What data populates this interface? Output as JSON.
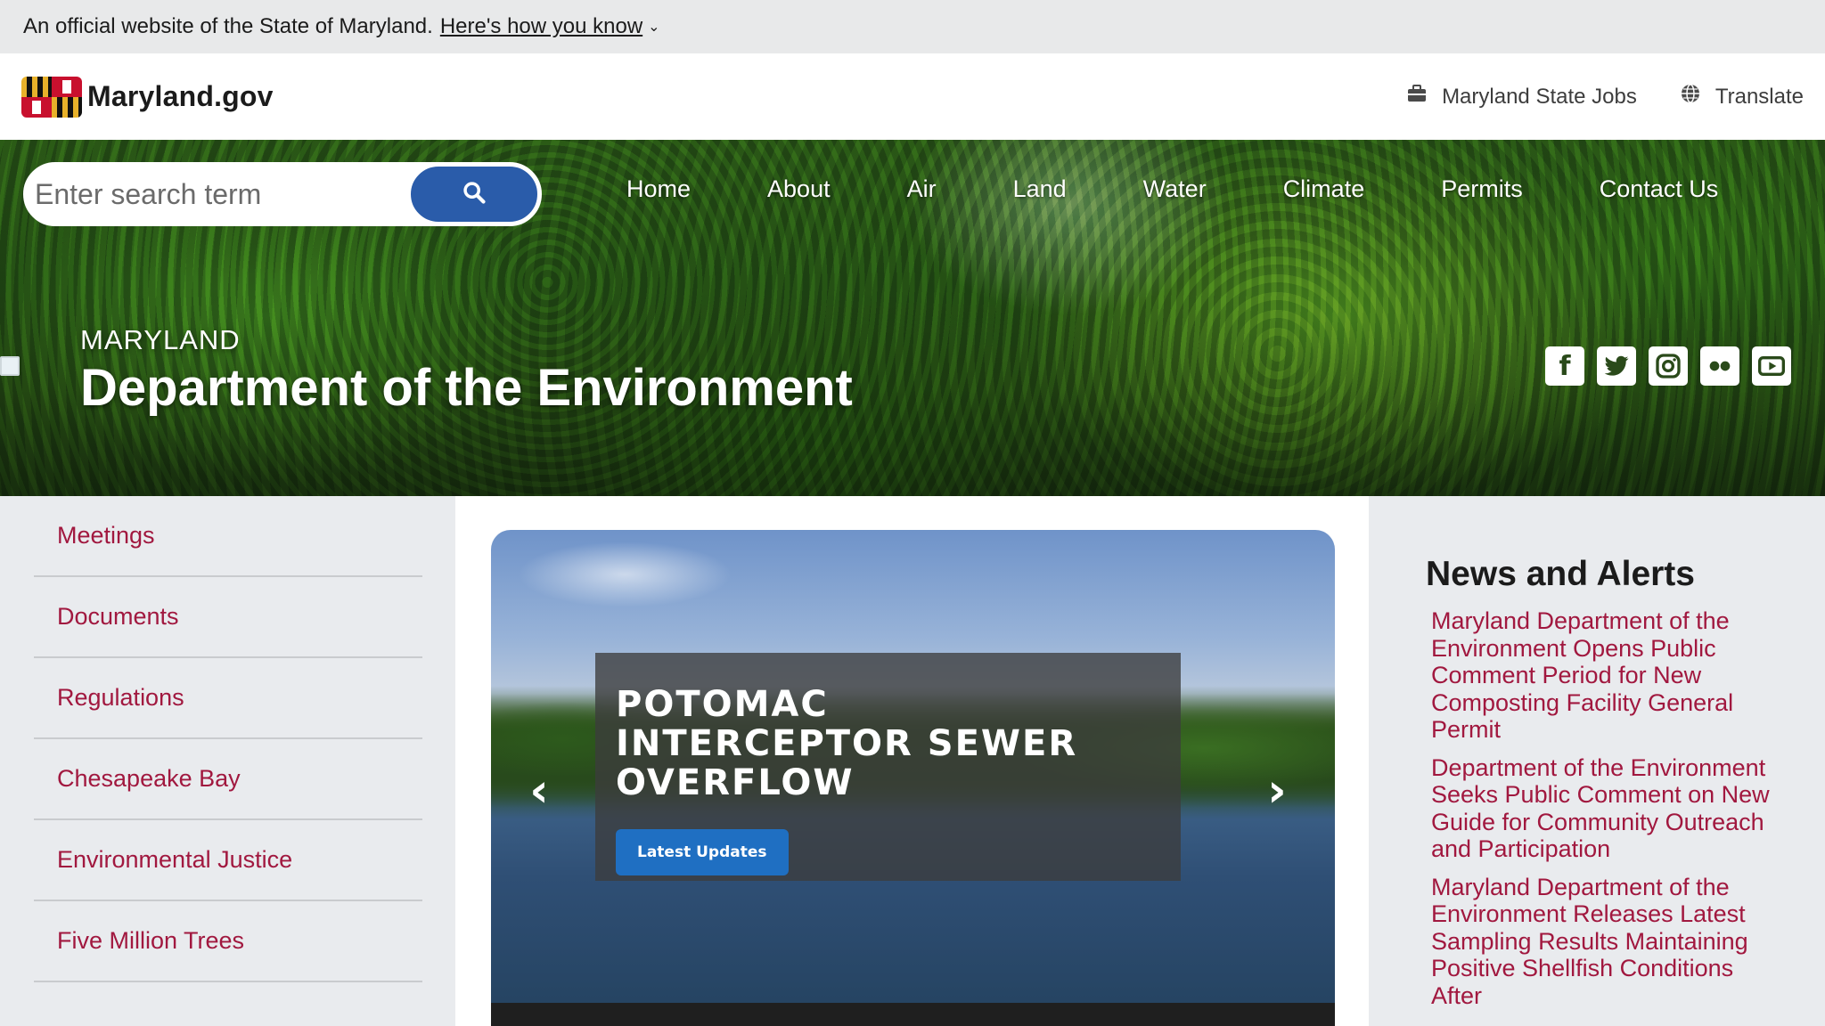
{
  "official_banner": {
    "text": "An official website of the State of Maryland.",
    "link": "Here's how you know"
  },
  "header": {
    "logo_text": "Maryland.gov",
    "jobs_link": "Maryland State Jobs",
    "translate_link": "Translate"
  },
  "search": {
    "placeholder": "Enter search term"
  },
  "nav": {
    "items": [
      "Home",
      "About",
      "Air",
      "Land",
      "Water",
      "Climate",
      "Permits",
      "Contact Us"
    ]
  },
  "hero": {
    "subtitle": "MARYLAND",
    "title": "Department of the Environment"
  },
  "social": [
    "facebook-icon",
    "twitter-icon",
    "instagram-icon",
    "flickr-icon",
    "youtube-icon"
  ],
  "sidebar": {
    "items": [
      "Meetings",
      "Documents",
      "Regulations",
      "Chesapeake Bay",
      "Environmental Justice",
      "Five Million Trees"
    ]
  },
  "carousel": {
    "slide_title": "POTOMAC INTERCEPTOR SEWER OVERFLOW",
    "button_label": "Latest Updates"
  },
  "news": {
    "heading": "News and Alerts",
    "items": [
      "Maryland Department of the Environment Opens Public Comment Period for New Composting Facility General Permit",
      "Department of the Environment Seeks Public Comment on New Guide for Community Outreach and Participation",
      "Maryland Department of the Environment Releases Latest Sampling Results Maintaining Positive Shellfish Conditions After"
    ]
  },
  "colors": {
    "accent_link": "#a1183f",
    "search_button": "#2a5caa",
    "slide_button": "#1f6fc2"
  }
}
